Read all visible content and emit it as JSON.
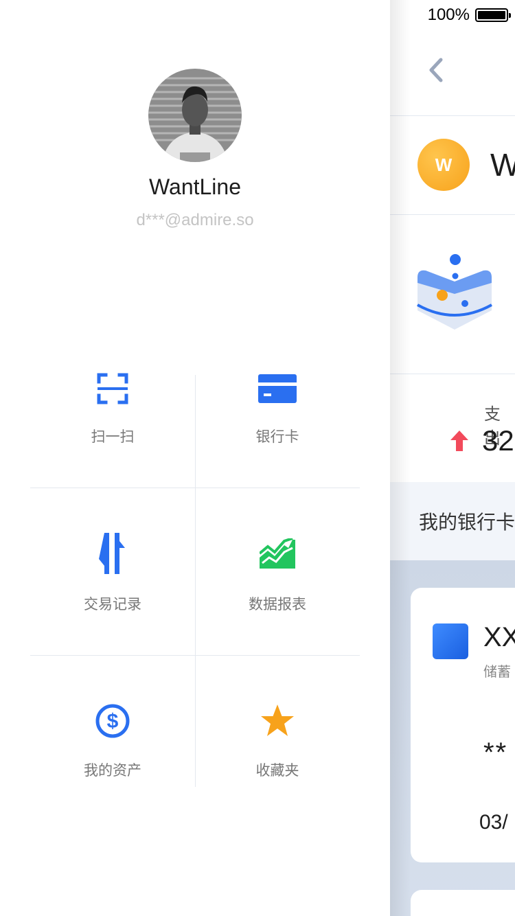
{
  "status_bar": {
    "battery_percent": "100%"
  },
  "main_screen": {
    "user_initial": "W",
    "user_name_partial": "W",
    "expense_label": "支出",
    "expense_value_partial": "32",
    "bank_section_title": "我的银行卡",
    "card": {
      "bank_name_partial": "XX",
      "card_type_partial": "储蓄",
      "number_partial": "**",
      "expiry_partial": "03/"
    }
  },
  "drawer": {
    "profile": {
      "name": "WantLine",
      "email": "d***@admire.so"
    },
    "menu": [
      {
        "label": "扫一扫",
        "icon": "scan-icon"
      },
      {
        "label": "银行卡",
        "icon": "bank-card-icon"
      },
      {
        "label": "交易记录",
        "icon": "transaction-icon"
      },
      {
        "label": "数据报表",
        "icon": "chart-icon"
      },
      {
        "label": "我的资产",
        "icon": "dollar-icon"
      },
      {
        "label": "收藏夹",
        "icon": "star-icon"
      }
    ]
  },
  "colors": {
    "accent_blue": "#2a6ff0",
    "green": "#22c55e",
    "orange": "#f7a21b",
    "up_arrow_red": "#f24a5b"
  }
}
